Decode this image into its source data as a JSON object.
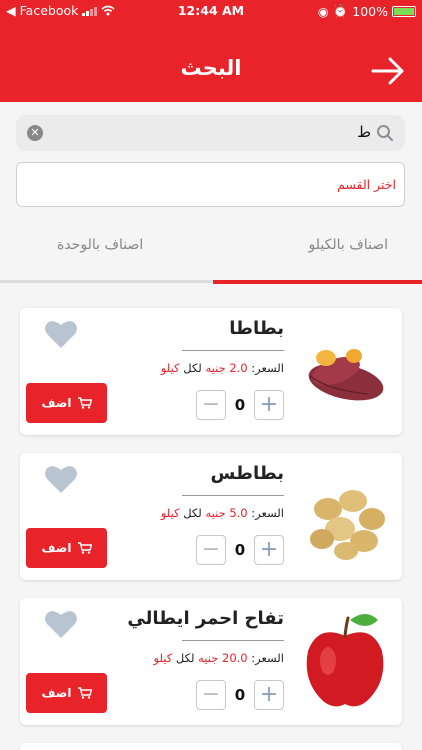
{
  "status_bar": {
    "carrier": "Facebook",
    "time": "12:44 AM",
    "battery": "100%"
  },
  "header": {
    "title": "البحث"
  },
  "search": {
    "value": "ط"
  },
  "category_select": {
    "placeholder": "اختر القسم"
  },
  "tabs": [
    {
      "label": "اصناف بالكيلو",
      "active": true
    },
    {
      "label": "اصناف بالوحدة",
      "active": false
    }
  ],
  "products": [
    {
      "name": "بطاطا",
      "price_label": "السعر:",
      "price": "2.0 جنيه",
      "per": "لكل",
      "unit": "كيلو",
      "quantity": "0",
      "add_label": "اضف",
      "image": "sweet-potato"
    },
    {
      "name": "بطاطس",
      "price_label": "السعر:",
      "price": "5.0 جنيه",
      "per": "لكل",
      "unit": "كيلو",
      "quantity": "0",
      "add_label": "اضف",
      "image": "potatoes"
    },
    {
      "name": "تفاح احمر ايطالي",
      "price_label": "السعر:",
      "price": "20.0 جنيه",
      "per": "لكل",
      "unit": "كيلو",
      "quantity": "0",
      "add_label": "اضف",
      "image": "red-apple"
    }
  ],
  "colors": {
    "accent": "#e8232a",
    "heart": "#b8c4d0",
    "background": "#f5f5f5"
  }
}
